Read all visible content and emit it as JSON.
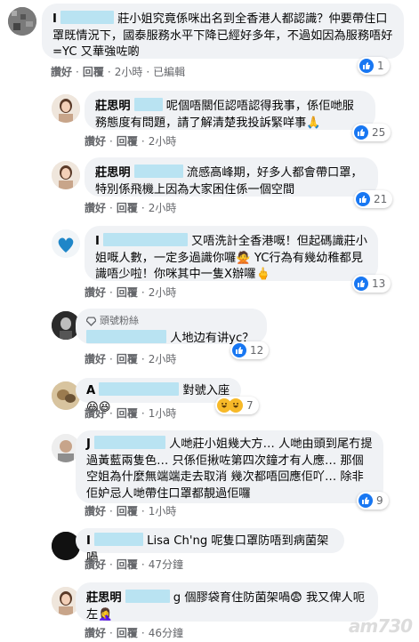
{
  "comments": [
    {
      "name": "I",
      "text": "莊小姐究竟係咪出名到全香港人都認識？仲要帶住口罩既情況下，國泰服務水平下降已經好多年，不過如因為服務唔好=YC 又華強咗啲",
      "actions": {
        "like": "讚好",
        "reply": "回覆",
        "time": "2小時",
        "edited": "已編輯"
      },
      "reaction_count": "1"
    },
    {
      "name": "莊思明",
      "text": "呢個唔關佢認唔認得我事，係佢哋服務態度有問題，請了解清楚我投訴緊咩事🙏",
      "actions": {
        "like": "讚好",
        "reply": "回覆",
        "time": "2小時"
      },
      "reaction_count": "25"
    },
    {
      "name": "莊思明",
      "text": "流感高峰期，好多人都會帶口罩，特別係飛機上因為大家困住係一個空間",
      "actions": {
        "like": "讚好",
        "reply": "回覆",
        "time": "2小時"
      },
      "reaction_count": "21"
    },
    {
      "name": "I",
      "text": "又唔洗計全香港嘅！但起碼識莊小姐嘅人數，一定多過識你囉🙅 YC行為有幾幼稚都見識唔少啦！你咪其中一隻X辦囉🖕",
      "actions": {
        "like": "讚好",
        "reply": "回覆",
        "time": "2小時"
      },
      "reaction_count": "13"
    },
    {
      "badge": "頭號粉絲",
      "text": "人地边有讲yc？",
      "actions": {
        "like": "讚好",
        "reply": "回覆",
        "time": "2小時"
      },
      "reaction_count": "12"
    },
    {
      "name": "A",
      "text": "對號入座😆😆",
      "actions": {
        "like": "讚好",
        "reply": "回覆",
        "time": "1小時"
      },
      "reaction_count": "7"
    },
    {
      "name": "J",
      "text": "人哋莊小姐幾大方… 人哋由頭到尾冇提過黃藍兩隻色… 只係佢揪咗第四次鐘才有人應… 那個空姐為什麼無端端走去取消 幾次都唔回應佢吖… 除非佢妒忌人哋帶住口罩都靚過佢囉",
      "actions": {
        "like": "讚好",
        "reply": "回覆",
        "time": "1小時"
      },
      "reaction_count": "9"
    },
    {
      "name": "I",
      "text": "Lisa Ch'ng 呢隻口罩防唔到病菌架喎",
      "actions": {
        "like": "讚好",
        "reply": "回覆",
        "time": "47分鐘"
      }
    },
    {
      "name": "莊思明",
      "text": "g 個膠袋育住防菌架喎😨 我又俾人呃左🤦‍♀️",
      "actions": {
        "like": "讚好",
        "reply": "回覆",
        "time": "46分鐘"
      }
    }
  ],
  "colors": {
    "redaction": "#b9e3f2",
    "bubble": "#f0f2f5",
    "like_blue": "#1877f2",
    "haha_yellow": "#f7b928"
  },
  "watermark": "am730"
}
